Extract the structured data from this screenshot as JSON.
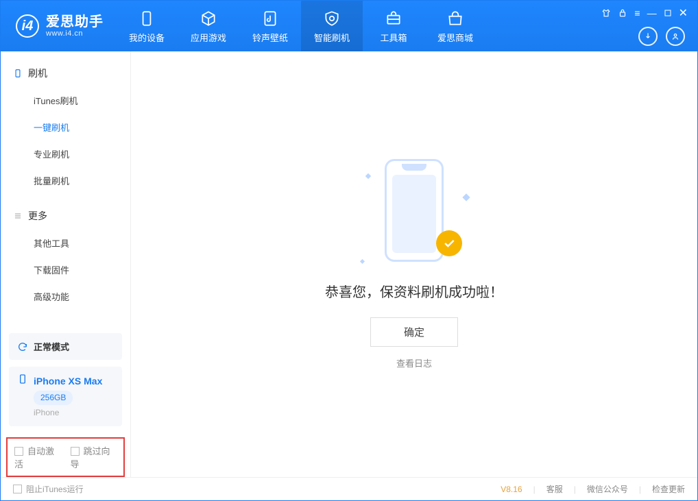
{
  "logo": {
    "name": "爱思助手",
    "site": "www.i4.cn"
  },
  "nav": {
    "items": [
      {
        "label": "我的设备"
      },
      {
        "label": "应用游戏"
      },
      {
        "label": "铃声壁纸"
      },
      {
        "label": "智能刷机"
      },
      {
        "label": "工具箱"
      },
      {
        "label": "爱思商城"
      }
    ]
  },
  "sidebar": {
    "section1_title": "刷机",
    "items1": [
      {
        "label": "iTunes刷机"
      },
      {
        "label": "一键刷机"
      },
      {
        "label": "专业刷机"
      },
      {
        "label": "批量刷机"
      }
    ],
    "section2_title": "更多",
    "items2": [
      {
        "label": "其他工具"
      },
      {
        "label": "下载固件"
      },
      {
        "label": "高级功能"
      }
    ]
  },
  "panel": {
    "mode": "正常模式",
    "device_name": "iPhone XS Max",
    "storage": "256GB",
    "device_type": "iPhone"
  },
  "options": {
    "auto_activate": "自动激活",
    "skip_guide": "跳过向导"
  },
  "main": {
    "success_title": "恭喜您，保资料刷机成功啦！",
    "confirm_label": "确定",
    "log_link": "查看日志"
  },
  "footer": {
    "block_itunes": "阻止iTunes运行",
    "version": "V8.16",
    "service": "客服",
    "wechat": "微信公众号",
    "update": "检查更新"
  }
}
